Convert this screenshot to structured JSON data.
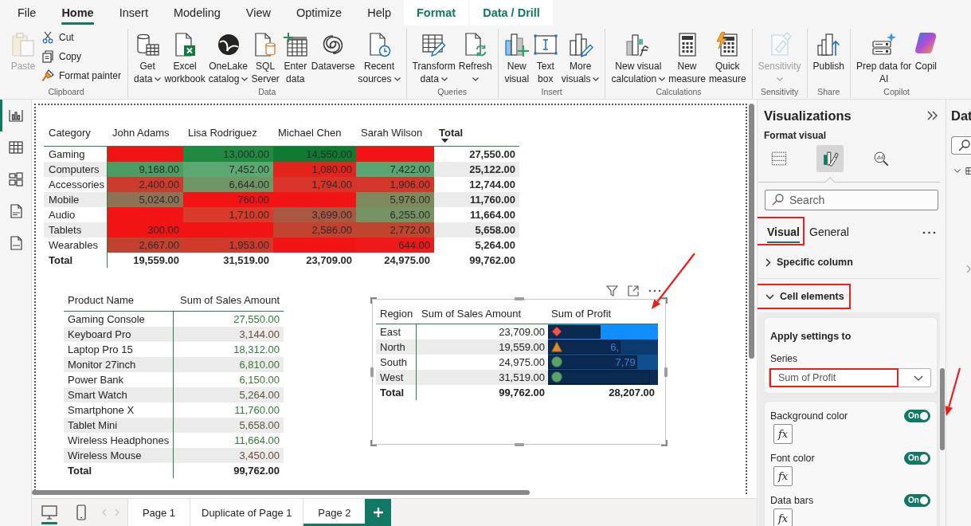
{
  "ribbon_tabs": [
    {
      "label": "File",
      "selected": false,
      "contextual": false
    },
    {
      "label": "Home",
      "selected": true,
      "contextual": false
    },
    {
      "label": "Insert",
      "selected": false,
      "contextual": false
    },
    {
      "label": "Modeling",
      "selected": false,
      "contextual": false
    },
    {
      "label": "View",
      "selected": false,
      "contextual": false
    },
    {
      "label": "Optimize",
      "selected": false,
      "contextual": false
    },
    {
      "label": "Help",
      "selected": false,
      "contextual": false
    },
    {
      "label": "Format",
      "selected": false,
      "contextual": true
    },
    {
      "label": "Data / Drill",
      "selected": false,
      "contextual": true
    }
  ],
  "ribbon_groups": [
    {
      "label": "Clipboard",
      "buttons": [
        {
          "label": "Paste",
          "kind": "large",
          "disabled": true
        },
        {
          "label": "Cut",
          "kind": "small",
          "disabled": false
        },
        {
          "label": "Copy",
          "kind": "small",
          "disabled": false
        },
        {
          "label": "Format painter",
          "kind": "small",
          "disabled": false
        }
      ]
    },
    {
      "label": "Data",
      "buttons": [
        {
          "label": "Get\ndata",
          "kind": "dropdown",
          "disabled": false
        },
        {
          "label": "Excel\nworkbook",
          "kind": "large",
          "disabled": false
        },
        {
          "label": "OneLake\ncatalog",
          "kind": "dropdown",
          "disabled": false
        },
        {
          "label": "SQL\nServer",
          "kind": "large",
          "disabled": false
        },
        {
          "label": "Enter\ndata",
          "kind": "large",
          "disabled": false
        },
        {
          "label": "Dataverse",
          "kind": "large",
          "disabled": false
        },
        {
          "label": "Recent\nsources",
          "kind": "dropdown",
          "disabled": false
        }
      ]
    },
    {
      "label": "Queries",
      "buttons": [
        {
          "label": "Transform\ndata",
          "kind": "dropdown",
          "disabled": false
        },
        {
          "label": "Refresh",
          "kind": "split",
          "disabled": false
        }
      ]
    },
    {
      "label": "Insert",
      "buttons": [
        {
          "label": "New\nvisual",
          "kind": "large",
          "disabled": false
        },
        {
          "label": "Text\nbox",
          "kind": "large",
          "disabled": false
        },
        {
          "label": "More\nvisuals",
          "kind": "dropdown",
          "disabled": false
        }
      ]
    },
    {
      "label": "Calculations",
      "buttons": [
        {
          "label": "New visual\ncalculation",
          "kind": "dropdown",
          "disabled": false
        },
        {
          "label": "New\nmeasure",
          "kind": "large",
          "disabled": false
        },
        {
          "label": "Quick\nmeasure",
          "kind": "large",
          "disabled": false
        }
      ]
    },
    {
      "label": "Sensitivity",
      "buttons": [
        {
          "label": "Sensitivity",
          "kind": "split",
          "disabled": true
        }
      ]
    },
    {
      "label": "Share",
      "buttons": [
        {
          "label": "Publish",
          "kind": "large",
          "disabled": false
        }
      ]
    },
    {
      "label": "Copilot",
      "buttons": [
        {
          "label": "Prep data for\nAI",
          "kind": "large",
          "disabled": false
        },
        {
          "label": "Copil",
          "kind": "large",
          "disabled": false
        }
      ]
    }
  ],
  "view_switcher": [
    {
      "selected": true
    },
    {
      "selected": false
    },
    {
      "selected": false
    },
    {
      "selected": false
    },
    {
      "selected": false
    }
  ],
  "matrix": {
    "columns": [
      {
        "label": "Category",
        "kind": "row_header",
        "sorted": false
      },
      {
        "label": "John Adams",
        "kind": "value",
        "sorted": false
      },
      {
        "label": "Lisa Rodriguez",
        "kind": "value",
        "sorted": false
      },
      {
        "label": "Michael Chen",
        "kind": "value",
        "sorted": false
      },
      {
        "label": "Sarah Wilson",
        "kind": "value",
        "sorted": false
      },
      {
        "label": "Total",
        "kind": "total",
        "sorted": true
      }
    ],
    "rows": [
      {
        "cells": [
          {
            "text": "Gaming"
          },
          {
            "color": "#f21414"
          },
          {
            "text": "13,000.00",
            "color": "#1f8a40"
          },
          {
            "text": "14,550.00",
            "color": "#0e7a32"
          },
          {
            "color": "#f21414"
          },
          {
            "text": "27,550.00"
          }
        ]
      },
      {
        "cells": [
          {
            "text": "Computers"
          },
          {
            "text": "9,168.00",
            "color": "#4b9d63"
          },
          {
            "text": "7,452.00",
            "color": "#5ba873"
          },
          {
            "text": "1,080.00",
            "color": "#e2241c"
          },
          {
            "text": "7,422.00",
            "color": "#59a672"
          },
          {
            "text": "25,122.00"
          }
        ]
      },
      {
        "cells": [
          {
            "text": "Accessories"
          },
          {
            "text": "2,400.00",
            "color": "#cc3b2d"
          },
          {
            "text": "6,644.00",
            "color": "#6f9665"
          },
          {
            "text": "1,794.00",
            "color": "#d8342a"
          },
          {
            "text": "1,906.00",
            "color": "#d5362a"
          },
          {
            "text": "12,744.00"
          }
        ]
      },
      {
        "cells": [
          {
            "text": "Mobile"
          },
          {
            "text": "5,024.00",
            "color": "#8c7355"
          },
          {
            "text": "760.00",
            "color": "#f21414"
          },
          {
            "color": "#f21414"
          },
          {
            "text": "5,976.00",
            "color": "#7e8a5c"
          },
          {
            "text": "11,760.00"
          }
        ]
      },
      {
        "cells": [
          {
            "text": "Audio"
          },
          {
            "color": "#f21414"
          },
          {
            "text": "1,710.00",
            "color": "#d93a2b"
          },
          {
            "text": "3,699.00",
            "color": "#aa5843"
          },
          {
            "text": "6,255.00",
            "color": "#759364"
          },
          {
            "text": "11,664.00"
          }
        ]
      },
      {
        "cells": [
          {
            "text": "Tablets"
          },
          {
            "text": "300.00",
            "color": "#f21414"
          },
          {
            "color": "#f21414"
          },
          {
            "text": "2,586.00",
            "color": "#c2432f"
          },
          {
            "text": "2,772.00",
            "color": "#bf452f"
          },
          {
            "text": "5,658.00"
          }
        ]
      },
      {
        "cells": [
          {
            "text": "Wearables"
          },
          {
            "text": "2,667.00",
            "color": "#c3412f"
          },
          {
            "text": "1,953.00",
            "color": "#cf3a2b"
          },
          {
            "color": "#f21414"
          },
          {
            "text": "644.00",
            "color": "#f01919"
          },
          {
            "text": "5,264.00"
          }
        ]
      }
    ],
    "total_row": {
      "cells": [
        {
          "text": "Total"
        },
        {
          "text": "19,559.00"
        },
        {
          "text": "31,519.00"
        },
        {
          "text": "23,709.00"
        },
        {
          "text": "24,975.00"
        },
        {
          "text": "99,762.00"
        }
      ]
    }
  },
  "product_table": {
    "columns": [
      "Product Name",
      "Sum of Sales Amount"
    ],
    "rows": [
      {
        "name": "Gaming Console",
        "value": "27,550.00",
        "color": "#2f7a3a"
      },
      {
        "name": "Keyboard Pro",
        "value": "3,144.00",
        "color": "#6b4d3c"
      },
      {
        "name": "Laptop Pro 15",
        "value": "18,312.00",
        "color": "#2f7a3a"
      },
      {
        "name": "Monitor 27inch",
        "value": "6,810.00",
        "color": "#3d7437"
      },
      {
        "name": "Power Bank",
        "value": "6,150.00",
        "color": "#3d7437"
      },
      {
        "name": "Smart Watch",
        "value": "5,264.00",
        "color": "#5a553a"
      },
      {
        "name": "Smartphone X",
        "value": "11,760.00",
        "color": "#2f7a3a"
      },
      {
        "name": "Tablet Mini",
        "value": "5,658.00",
        "color": "#5a553a"
      },
      {
        "name": "Wireless Headphones",
        "value": "11,664.00",
        "color": "#2f7a3a"
      },
      {
        "name": "Wireless Mouse",
        "value": "3,450.00",
        "color": "#6b4d3c"
      }
    ],
    "total": {
      "name": "Total",
      "value": "99,762.00"
    }
  },
  "region_table": {
    "selected": true,
    "columns": [
      "Region",
      "Sum of Sales Amount",
      "Sum of Profit"
    ],
    "rows": [
      {
        "region": "East",
        "sales": "23,709.00",
        "profit": {
          "kind": "bad",
          "color": "#118dff",
          "level": 0.48
        }
      },
      {
        "region": "North",
        "sales": "19,559.00",
        "profit": {
          "kind": "warning",
          "color": "#0d3a6e",
          "level": 0.66,
          "value": "6,"
        }
      },
      {
        "region": "South",
        "sales": "24,975.00",
        "profit": {
          "kind": "good",
          "color": "#0f4f8e",
          "level": 0.81,
          "value": "7,79"
        }
      },
      {
        "region": "West",
        "sales": "31,519.00",
        "profit": {
          "kind": "good",
          "color": "#0b2c54",
          "level": 0.93
        }
      }
    ],
    "total": {
      "region": "Total",
      "sales": "99,762.00",
      "profit": "28,207.00"
    }
  },
  "page_bar": {
    "layouts": [
      {
        "selected": true
      },
      {
        "selected": false
      }
    ],
    "pages": [
      {
        "label": "Page 1",
        "selected": false
      },
      {
        "label": "Duplicate of Page 1",
        "selected": false
      },
      {
        "label": "Page 2",
        "selected": true
      }
    ]
  },
  "visualizations_pane": {
    "title": "Visualizations",
    "subtitle": "Format visual",
    "pane_tabs": [
      {
        "selected": false
      },
      {
        "selected": true
      },
      {
        "selected": false
      }
    ],
    "search": {
      "placeholder": "Search"
    },
    "tabs": [
      {
        "label": "Visual",
        "selected": true,
        "highlighted": true
      },
      {
        "label": "General",
        "selected": false,
        "highlighted": false
      }
    ],
    "sections": [
      {
        "label": "Specific column",
        "expanded": false,
        "highlighted": false
      },
      {
        "label": "Cell elements",
        "expanded": true,
        "highlighted": true,
        "apply_settings": {
          "title": "Apply settings to",
          "series_label": "Series",
          "series_value": "Sum of Profit",
          "highlighted": true
        },
        "settings": [
          {
            "label": "Background color",
            "on": true,
            "toggle_label": "On",
            "function_button": "fx"
          },
          {
            "label": "Font color",
            "on": true,
            "toggle_label": "On",
            "function_button": "fx"
          },
          {
            "label": "Data bars",
            "on": true,
            "toggle_label": "On",
            "function_button": "fx"
          }
        ]
      }
    ]
  },
  "data_pane": {
    "title": "Dat"
  }
}
